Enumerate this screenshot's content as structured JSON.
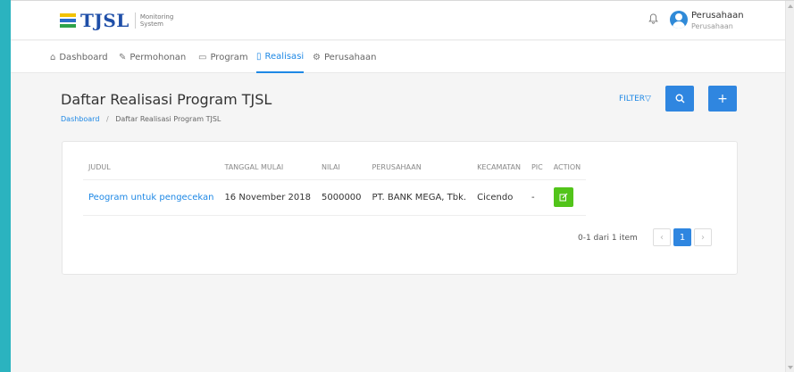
{
  "header": {
    "brand": "TJSL",
    "brand_sub_line1": "Monitoring",
    "brand_sub_line2": "System",
    "user_name": "Perusahaan",
    "user_role": "Perusahaan"
  },
  "nav": {
    "items": [
      {
        "label": "Dashboard",
        "icon": "home-icon"
      },
      {
        "label": "Permohonan",
        "icon": "pencil-icon"
      },
      {
        "label": "Program",
        "icon": "folder-icon"
      },
      {
        "label": "Realisasi",
        "icon": "file-icon"
      },
      {
        "label": "Perusahaan",
        "icon": "gear-icon"
      }
    ],
    "active": "Realisasi"
  },
  "page": {
    "title": "Daftar Realisasi Program TJSL",
    "breadcrumb": [
      "Dashboard",
      "Daftar Realisasi Program TJSL"
    ],
    "filter_label": "FILTER"
  },
  "table": {
    "headers": [
      "JUDUL",
      "TANGGAL MULAI",
      "NILAI",
      "PERUSAHAAN",
      "KECAMATAN",
      "PIC",
      "ACTION"
    ],
    "rows": [
      {
        "judul": "Peogram untuk pengecekan",
        "tanggal_mulai": "16 November 2018",
        "nilai": "5000000",
        "perusahaan": "PT. BANK MEGA, Tbk.",
        "kecamatan": "Cicendo",
        "pic": "-"
      }
    ]
  },
  "pagination": {
    "info": "0-1 dari 1 item",
    "prev": "‹",
    "current": "1",
    "next": "›"
  },
  "colors": {
    "accent": "#1e88e5",
    "primary_button": "#2f86e0",
    "edit_button": "#52c41a",
    "page_frame": "#2bb3bf"
  }
}
